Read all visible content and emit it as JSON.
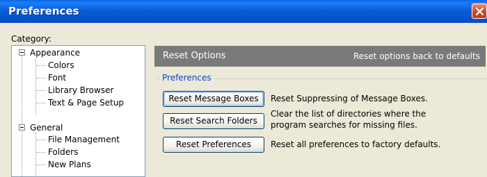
{
  "window": {
    "title": "Preferences"
  },
  "category_label": "Category:",
  "tree": {
    "appearance": {
      "label": "Appearance",
      "children": [
        "Colors",
        "Font",
        "Library Browser",
        "Text & Page Setup"
      ]
    },
    "general": {
      "label": "General",
      "children": [
        "File Management",
        "Folders",
        "New Plans"
      ]
    }
  },
  "panel": {
    "title": "Reset Options",
    "subtitle": "Reset options back to defaults",
    "group_label": "Preferences",
    "actions": [
      {
        "button": "Reset Message Boxes",
        "description": [
          "Reset Suppressing of Message Boxes."
        ]
      },
      {
        "button": "Reset Search Folders",
        "description": [
          "Clear the list of directories where the",
          "program searches for missing files."
        ]
      },
      {
        "button": "Reset Preferences",
        "description": [
          "Reset all preferences to factory defaults."
        ]
      }
    ]
  }
}
